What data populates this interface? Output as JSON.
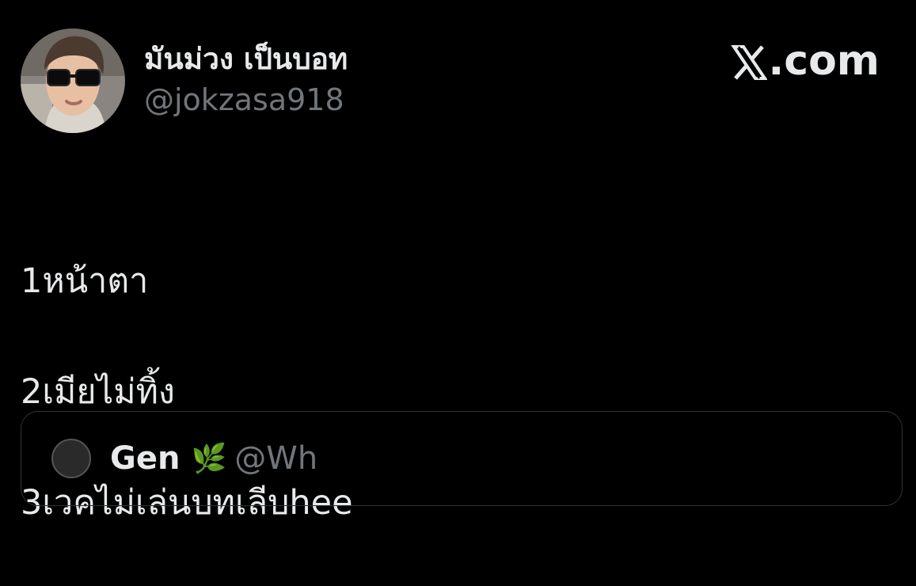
{
  "author": {
    "display_name": "มันม่วง เป็นบอท",
    "handle": "@jokzasa918",
    "avatar": "profile-photo-sunglasses"
  },
  "brand": {
    "logo_icon": "x-logo-icon",
    "label": ".com"
  },
  "tweet": {
    "lines": [
      "1หน้าตา",
      "2เมียไม่ทิ้ง",
      "3เวคไม่เล่นบทเลีบhee"
    ]
  },
  "quoted_tweet": {
    "display_name": "Gen",
    "emoji": "🌿",
    "handle": "@Wh"
  },
  "colors": {
    "background": "#000000",
    "text_primary": "#e7e9ea",
    "text_secondary": "#71767b",
    "border": "#2f3336"
  }
}
